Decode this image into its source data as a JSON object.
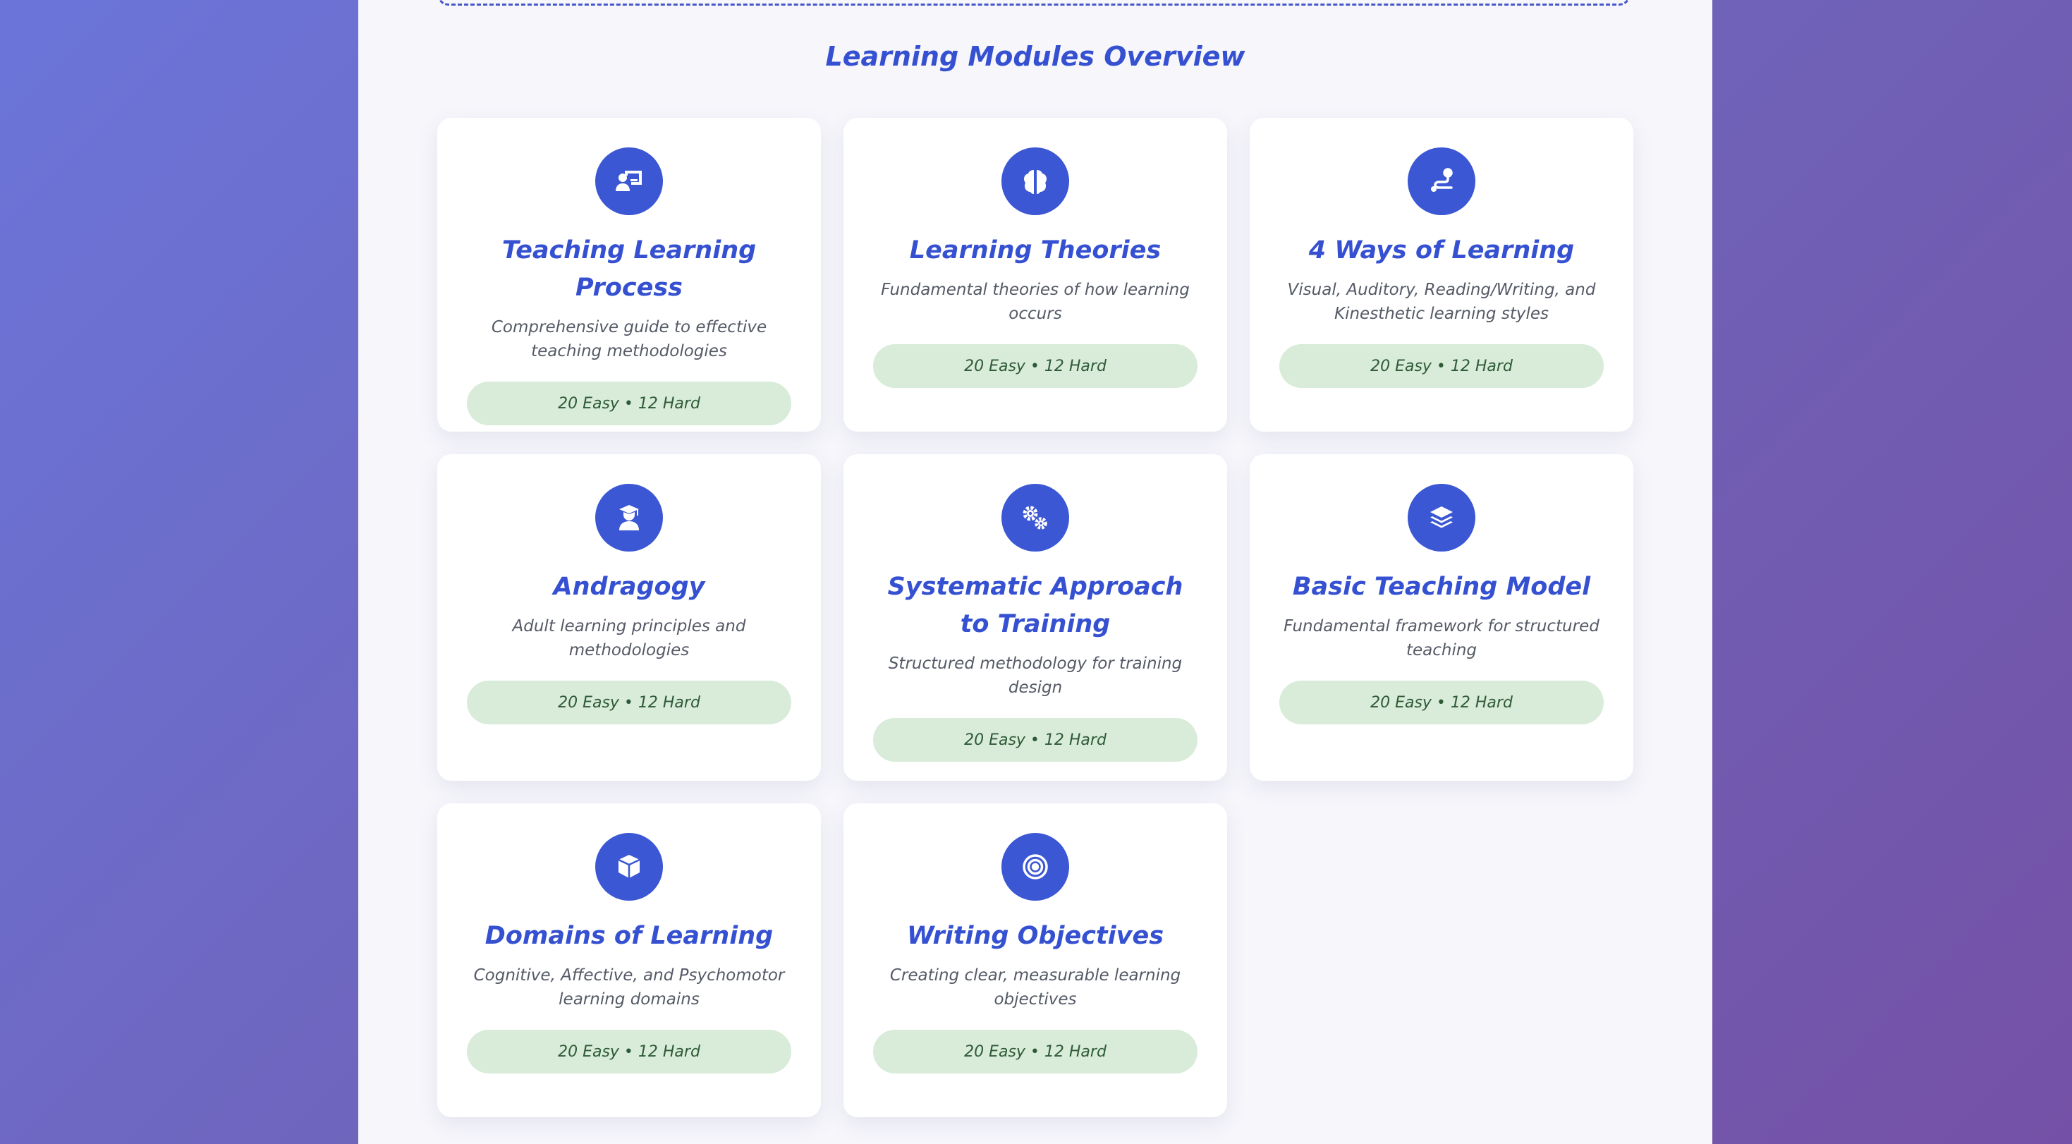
{
  "section": {
    "title": "Learning Modules Overview"
  },
  "colors": {
    "accent": "#3551d1",
    "icon_bg": "#3b57d4",
    "badge_bg": "#d8ecd9",
    "badge_text": "#2f5a37"
  },
  "modules": [
    {
      "icon": "chalkboard-teacher-icon",
      "title": "Teaching Learning Process",
      "description": "Comprehensive guide to effective teaching methodologies",
      "stats": "20 Easy • 12 Hard"
    },
    {
      "icon": "brain-icon",
      "title": "Learning Theories",
      "description": "Fundamental theories of how learning occurs",
      "stats": "20 Easy • 12 Hard"
    },
    {
      "icon": "route-icon",
      "title": "4 Ways of Learning",
      "description": "Visual, Auditory, Reading/Writing, and Kinesthetic learning styles",
      "stats": "20 Easy • 12 Hard"
    },
    {
      "icon": "graduate-user-icon",
      "title": "Andragogy",
      "description": "Adult learning principles and methodologies",
      "stats": "20 Easy • 12 Hard"
    },
    {
      "icon": "cogs-icon",
      "title": "Systematic Approach to Training",
      "description": "Structured methodology for training design",
      "stats": "20 Easy • 12 Hard"
    },
    {
      "icon": "layer-group-icon",
      "title": "Basic Teaching Model",
      "description": "Fundamental framework for structured teaching",
      "stats": "20 Easy • 12 Hard"
    },
    {
      "icon": "cube-icon",
      "title": "Domains of Learning",
      "description": "Cognitive, Affective, and Psychomotor learning domains",
      "stats": "20 Easy • 12 Hard"
    },
    {
      "icon": "bullseye-icon",
      "title": "Writing Objectives",
      "description": "Creating clear, measurable learning objectives",
      "stats": "20 Easy • 12 Hard"
    }
  ]
}
